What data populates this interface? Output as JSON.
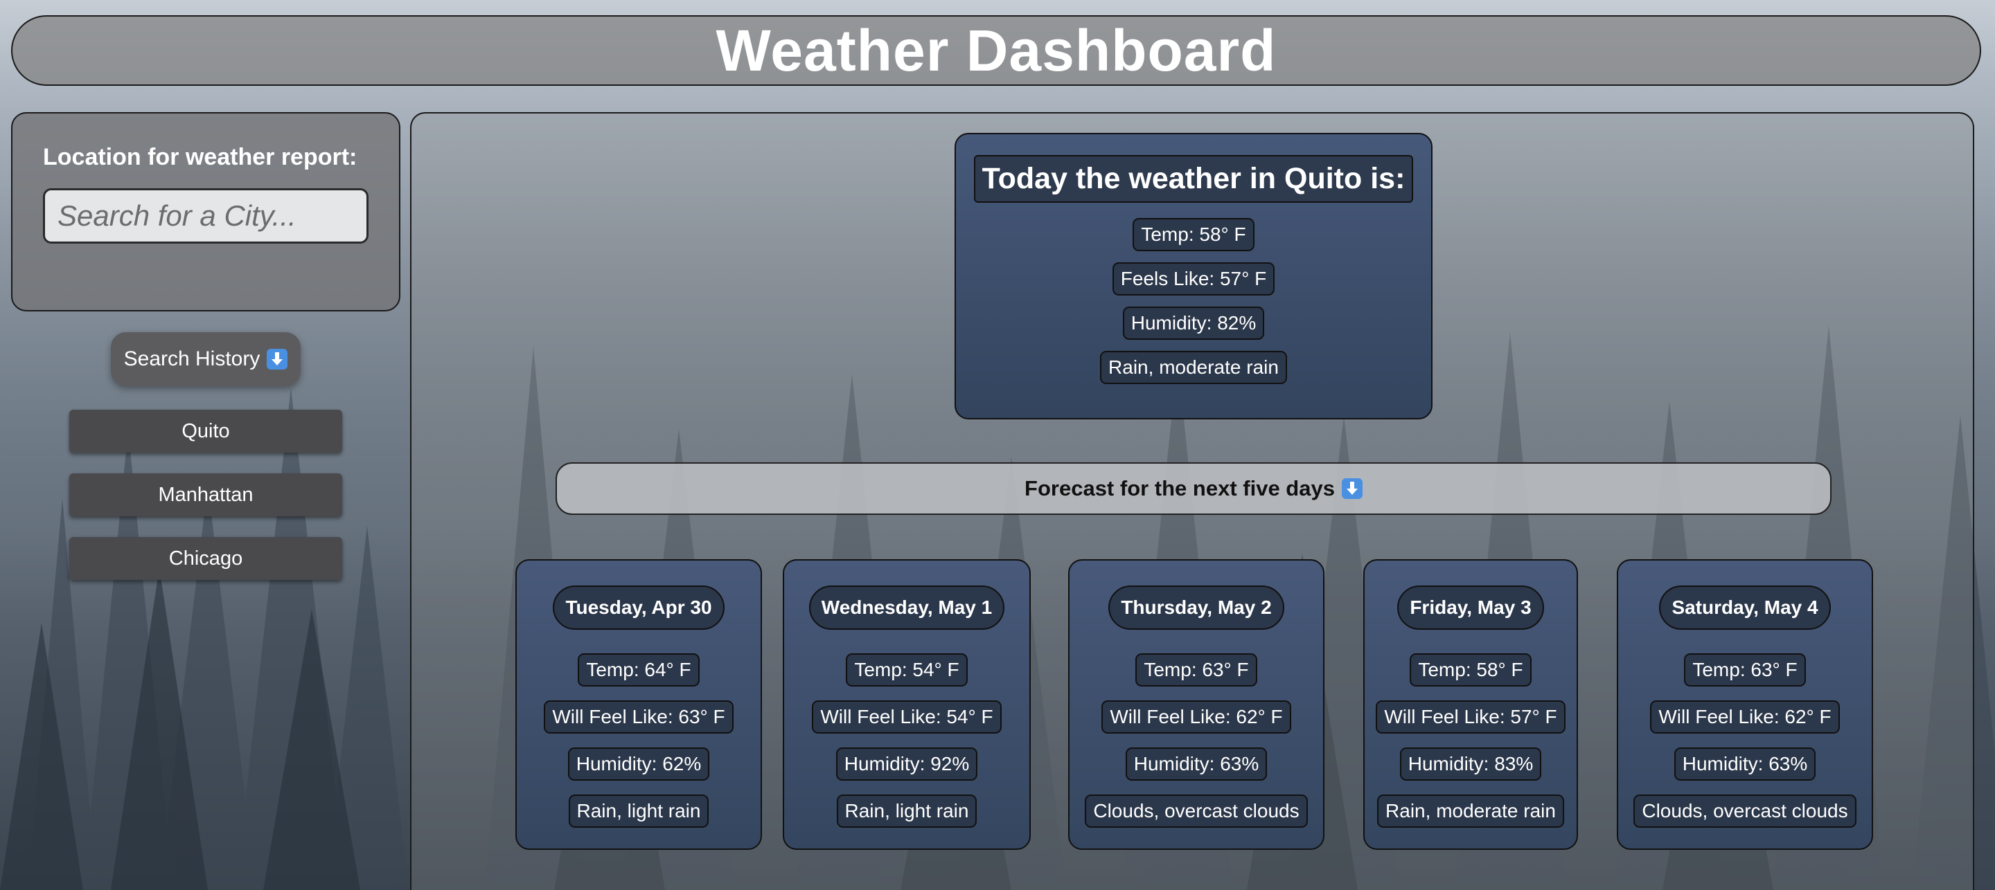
{
  "header": {
    "title": "Weather Dashboard"
  },
  "search": {
    "label": "Location for weather report:",
    "placeholder": "Search for a City...",
    "history_button_label": "Search History",
    "history_icon": "down-arrow-icon",
    "history": [
      "Quito",
      "Manhattan",
      "Chicago"
    ]
  },
  "today": {
    "title": "Today the weather in Quito is:",
    "temp": "Temp: 58° F",
    "feels_like": "Feels Like: 57° F",
    "humidity": "Humidity: 82%",
    "description": "Rain, moderate rain"
  },
  "forecast": {
    "heading": "Forecast for the next five days",
    "heading_icon": "down-arrow-icon",
    "days": [
      {
        "date": "Tuesday, Apr 30",
        "temp": "Temp: 64° F",
        "feels": "Will Feel Like: 63° F",
        "humidity": "Humidity: 62%",
        "description": "Rain, light rain"
      },
      {
        "date": "Wednesday, May 1",
        "temp": "Temp: 54° F",
        "feels": "Will Feel Like: 54° F",
        "humidity": "Humidity: 92%",
        "description": "Rain, light rain"
      },
      {
        "date": "Thursday, May 2",
        "temp": "Temp: 63° F",
        "feels": "Will Feel Like: 62° F",
        "humidity": "Humidity: 63%",
        "description": "Clouds, overcast clouds"
      },
      {
        "date": "Friday, May 3",
        "temp": "Temp: 58° F",
        "feels": "Will Feel Like: 57° F",
        "humidity": "Humidity: 83%",
        "description": "Rain, moderate rain"
      },
      {
        "date": "Saturday, May 4",
        "temp": "Temp: 63° F",
        "feels": "Will Feel Like: 62° F",
        "humidity": "Humidity: 63%",
        "description": "Clouds, overcast clouds"
      }
    ]
  },
  "colors": {
    "card_bg": "#3d4f6b",
    "pill_bg": "#2b374a",
    "panel_bg": "#737376",
    "arrow_icon": "#4a90e2"
  }
}
